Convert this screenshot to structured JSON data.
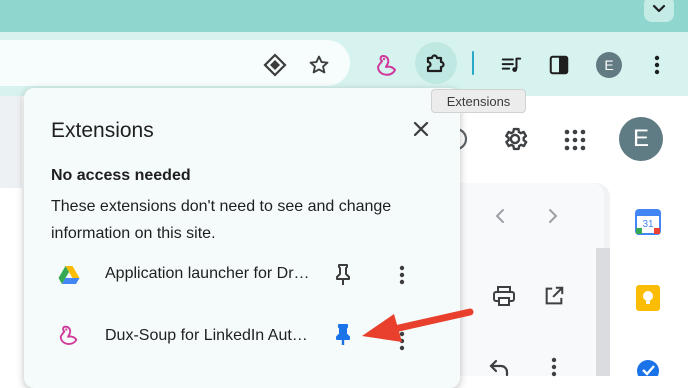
{
  "browser": {
    "tooltip": "Extensions",
    "profile_initial": "E",
    "icons": {
      "tab_search": "chevron-down-icon",
      "site_lens": "lens-icon",
      "bookmark": "star-icon",
      "dux_soup": "dux-soup-icon",
      "extensions": "puzzle-icon",
      "media": "media-control-icon",
      "side_panel": "side-panel-icon",
      "menu": "kebab-menu-icon"
    },
    "accent": "#1a73e8"
  },
  "page": {
    "profile_initial": "E"
  },
  "popup": {
    "title": "Extensions",
    "section_title": "No access needed",
    "section_desc": "These extensions don't need to see and change information on this site.",
    "extensions": [
      {
        "name": "Application launcher for Drive (by Google)",
        "pinned": false
      },
      {
        "name": "Dux-Soup for LinkedIn Automation",
        "pinned": true
      }
    ]
  },
  "colors": {
    "tabstrip": "#8fd6cf",
    "toolbar": "#d6f3f0",
    "popup_bg": "#f4fbfa",
    "pin_active": "#1a73e8",
    "arrow": "#e8402d"
  }
}
